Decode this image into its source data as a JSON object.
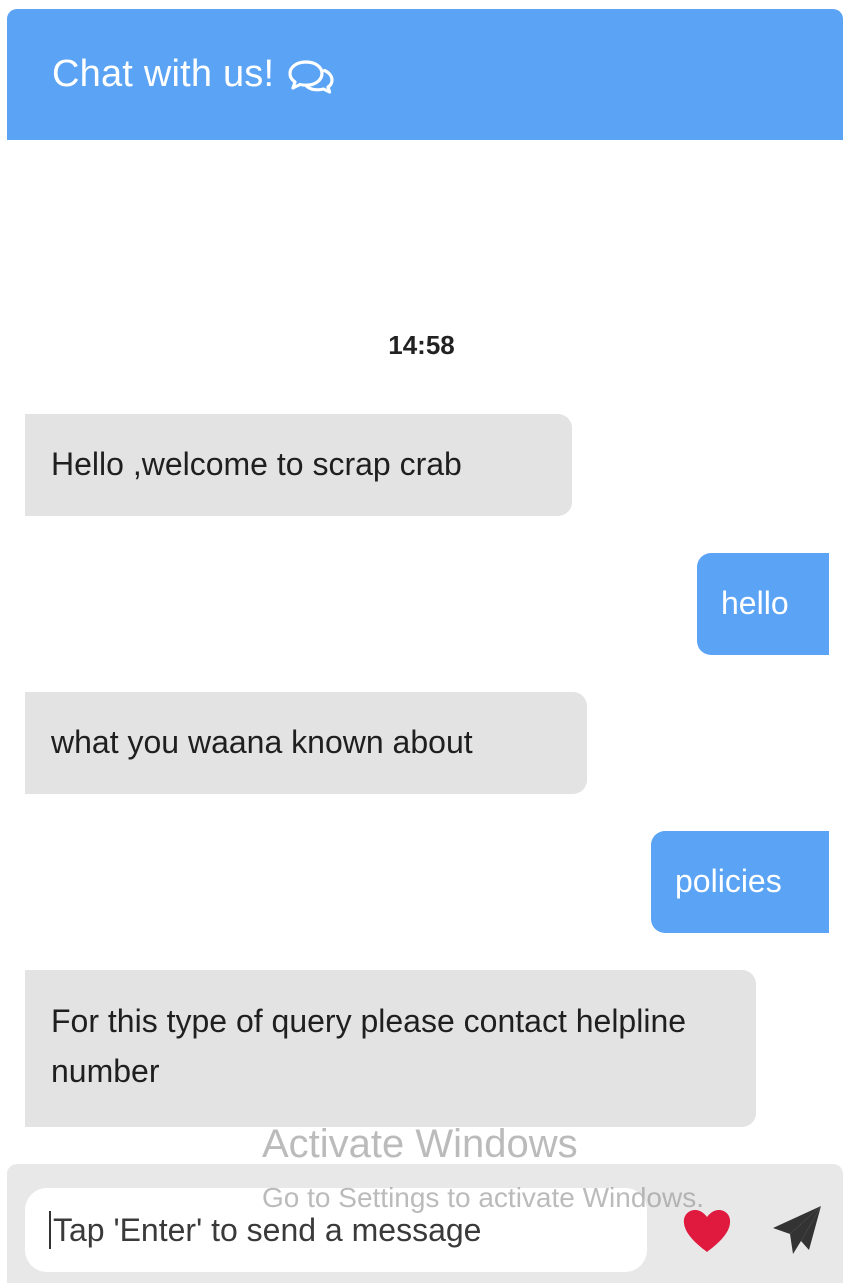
{
  "header": {
    "title": "Chat with us!",
    "icon": "chat-bubbles-icon",
    "background": "#5aa3f5"
  },
  "chat": {
    "timestamp": "14:58",
    "messages": [
      {
        "sender": "bot",
        "text": "Hello ,welcome to scrap crab"
      },
      {
        "sender": "user",
        "text": "hello"
      },
      {
        "sender": "bot",
        "text": "what you waana known about"
      },
      {
        "sender": "user",
        "text": "policies"
      },
      {
        "sender": "bot",
        "text": "For this type of query please contact helpline number"
      }
    ],
    "bot_bubble_color": "#e3e3e3",
    "user_bubble_color": "#5aa3f5"
  },
  "composer": {
    "placeholder": "Tap 'Enter' to send a message",
    "like_icon": "heart-icon",
    "like_color": "#e0193f",
    "send_icon": "paper-plane-icon"
  },
  "watermark": {
    "title": "Activate Windows",
    "subtitle": "Go to Settings to activate Windows."
  }
}
